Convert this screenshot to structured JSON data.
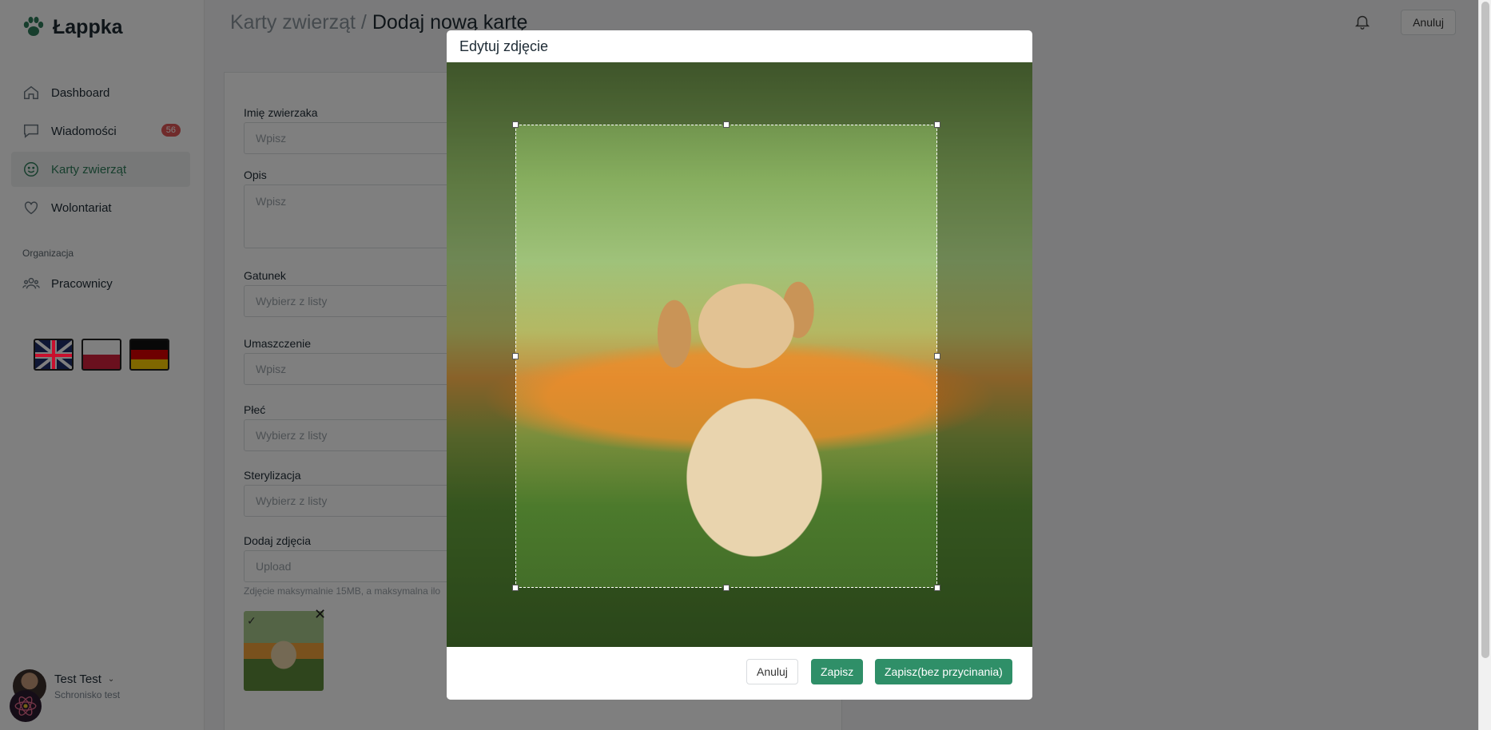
{
  "app": {
    "name": "Łappka"
  },
  "sidebar": {
    "items": [
      {
        "label": "Dashboard",
        "icon": "home-icon"
      },
      {
        "label": "Wiadomości",
        "icon": "chat-icon",
        "badge": "56"
      },
      {
        "label": "Karty zwierząt",
        "icon": "smile-icon",
        "active": true
      },
      {
        "label": "Wolontariat",
        "icon": "heart-icon"
      }
    ],
    "section_label": "Organizacja",
    "section_items": [
      {
        "label": "Pracownicy",
        "icon": "users-icon"
      }
    ],
    "flags": [
      "flag-uk",
      "flag-pl",
      "flag-de"
    ]
  },
  "user": {
    "name": "Test Test",
    "subtitle": "Schronisko test"
  },
  "header": {
    "crumb_parent": "Karty zwierząt / ",
    "crumb_current": "Dodaj nową kartę",
    "cancel_label": "Anuluj"
  },
  "form": {
    "name_label": "Imię zwierzaka",
    "name_placeholder": "Wpisz",
    "description_label": "Opis",
    "description_placeholder": "Wpisz",
    "species_label": "Gatunek",
    "species_placeholder": "Wybierz z listy",
    "color_label": "Umaszczenie",
    "color_placeholder": "Wpisz",
    "sex_label": "Płeć",
    "sex_placeholder": "Wybierz z listy",
    "sterilization_label": "Sterylizacja",
    "sterilization_placeholder": "Wybierz z listy",
    "photos_label": "Dodaj zdjęcia",
    "photos_placeholder": "Upload",
    "photos_hint": "Zdjęcie maksymalnie 15MB, a maksymalna ilo"
  },
  "modal": {
    "title": "Edytuj zdjęcie",
    "cancel_label": "Anuluj",
    "save_label": "Zapisz",
    "save_nocrop_label": "Zapisz(bez przycinania)"
  },
  "colors": {
    "accent": "#2f8f68",
    "badge": "#e05656"
  }
}
